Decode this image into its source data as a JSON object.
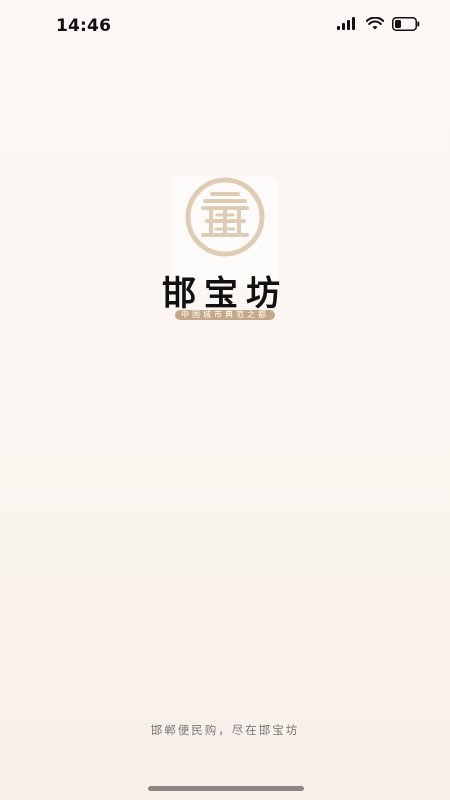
{
  "status_bar": {
    "time": "14:46",
    "icons": [
      "cellular-signal-icon",
      "wifi-icon",
      "battery-icon"
    ]
  },
  "splash": {
    "logo_icon": "pavilion-roof-circle-logo",
    "brand_name": "邯宝坊",
    "slogan": "中国城市典范之都",
    "tagline": "邯郸便民购，尽在邯宝坊"
  },
  "colors": {
    "brand_gold": "#b98f5b",
    "background": "#fbf7f4",
    "tagline_text": "#777777",
    "home_indicator": "#8c8784"
  }
}
